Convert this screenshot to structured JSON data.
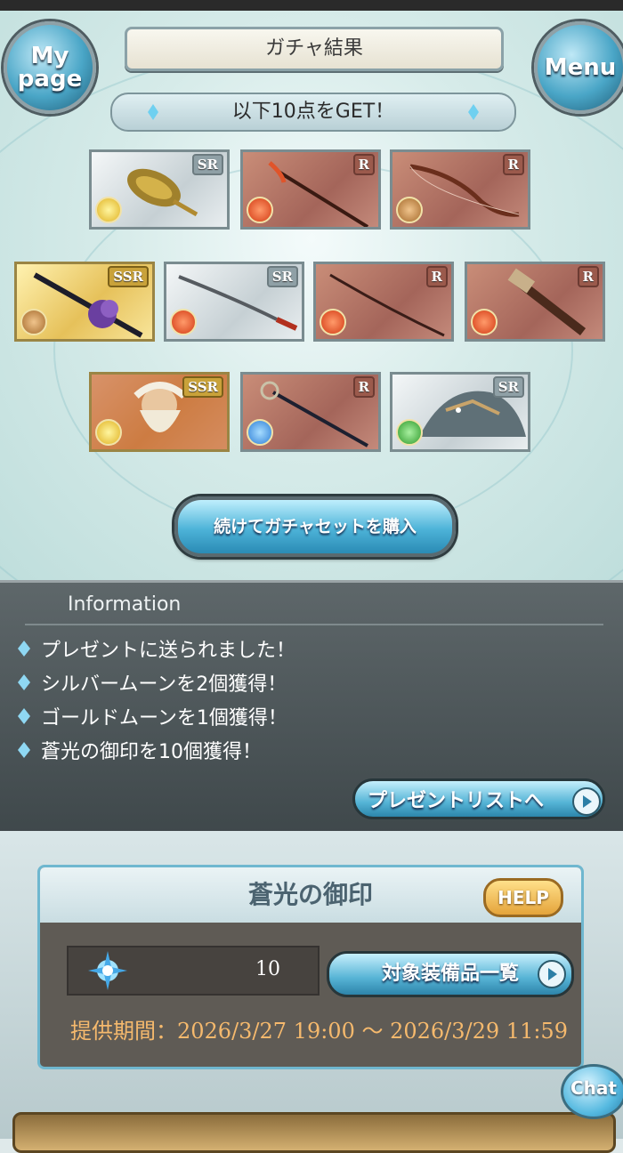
{
  "header": {
    "title": "ガチャ結果",
    "mypage_label": "My\npage",
    "menu_label": "Menu"
  },
  "result": {
    "banner": "以下10点をGET！",
    "cards": [
      {
        "rarity": "SR",
        "element": "light",
        "icon": "golden-ornament-weapon"
      },
      {
        "rarity": "R",
        "element": "fire",
        "icon": "staff-weapon"
      },
      {
        "rarity": "R",
        "element": "earth",
        "icon": "bow-weapon"
      },
      {
        "rarity": "SSR",
        "element": "earth",
        "icon": "flower-spear-weapon"
      },
      {
        "rarity": "SR",
        "element": "fire",
        "icon": "katana-weapon"
      },
      {
        "rarity": "R",
        "element": "fire",
        "icon": "long-katana-weapon"
      },
      {
        "rarity": "R",
        "element": "fire",
        "icon": "gun-weapon"
      },
      {
        "rarity": "SSR",
        "element": "light",
        "icon": "bearded-character"
      },
      {
        "rarity": "R",
        "element": "water",
        "icon": "scepter-weapon"
      },
      {
        "rarity": "SR",
        "element": "wind",
        "icon": "dragon-summon"
      }
    ],
    "buy_button": "続けてガチャセットを購入"
  },
  "information": {
    "title": "Information",
    "items": [
      "プレゼントに送られました！",
      "シルバームーンを2個獲得！",
      "ゴールドムーンを1個獲得！",
      "蒼光の御印を10個獲得！"
    ],
    "present_button": "プレゼントリストへ"
  },
  "seal_panel": {
    "title": "蒼光の御印",
    "help_button": "HELP",
    "count": "10",
    "equip_button": "対象装備品一覧",
    "period": "提供期間：2026/3/27 19:00 ～ 2026/3/29 11:59"
  },
  "chat_label": "Chat",
  "colors": {
    "accent_blue": "#4db3d8",
    "period_text": "#f5b96d",
    "info_bg": "#4a5356"
  }
}
